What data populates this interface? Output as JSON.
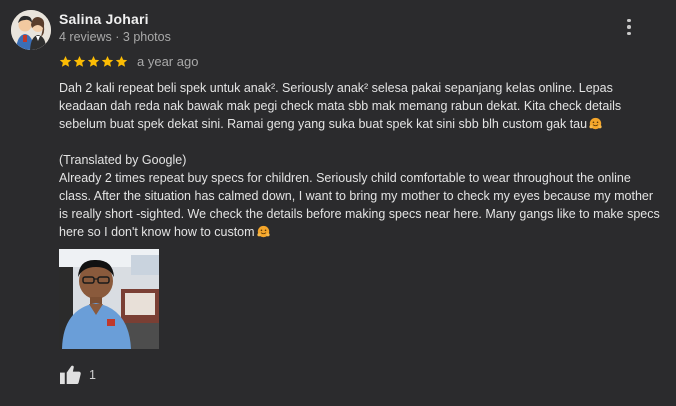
{
  "reviewer": {
    "name": "Salina Johari",
    "meta": "4 reviews · 3 photos"
  },
  "rating": {
    "stars": 5,
    "max": 5,
    "color": "#fbbc04"
  },
  "review": {
    "date": "a year ago",
    "original": "Dah 2 kali repeat beli spek untuk anak². Seriously anak² selesa pakai sepanjang kelas online. Lepas keadaan dah reda nak bawak mak pegi check mata sbb mak memang rabun dekat. Kita check details sebelum buat spek dekat sini. Ramai geng yang suka buat spek kat sini sbb blh custom gak tau",
    "translated_label": "(Translated by Google)",
    "translated": "Already 2 times repeat buy specs for children. Seriously child comfortable to wear throughout the online class. After the situation has calmed down, I want to bring my mother to check my eyes because my mother is really short -sighted. We check the details before making specs near here. Many gangs like to make specs here so I don't know how to custom",
    "emoji": "hugging-face-emoji"
  },
  "photo": {
    "count": 1
  },
  "likes": {
    "count": "1",
    "icon": "thumbs-up-icon"
  },
  "icons": {
    "more": "more-vert-icon",
    "star": "star-icon"
  }
}
